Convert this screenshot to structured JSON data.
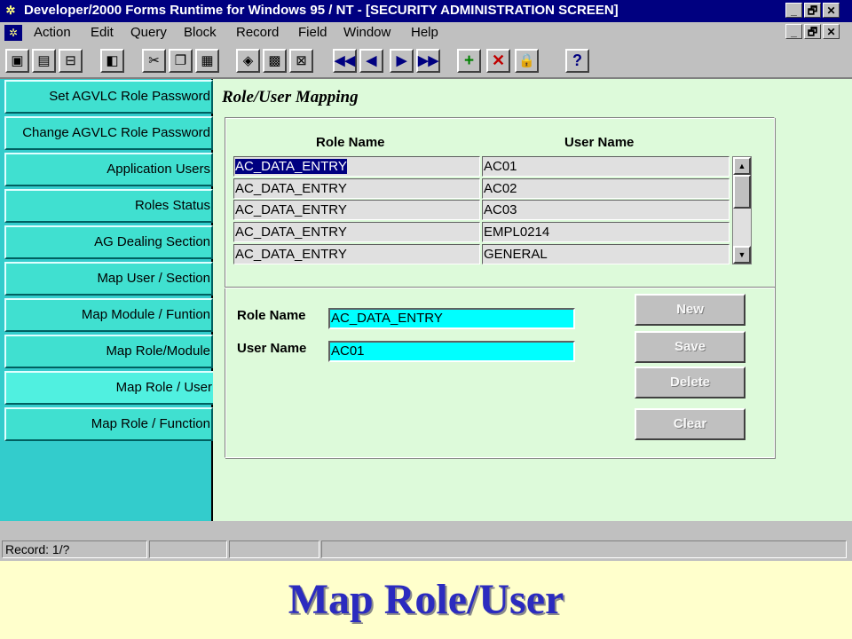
{
  "window": {
    "title": "Developer/2000 Forms Runtime for Windows 95 / NT - [SECURITY ADMINISTRATION SCREEN]",
    "title_buttons": [
      "_",
      "🗗",
      "✕"
    ],
    "menu_buttons": [
      "_",
      "🗗",
      "✕"
    ]
  },
  "menu": {
    "items": [
      "Action",
      "Edit",
      "Query",
      "Block",
      "Record",
      "Field",
      "Window",
      "Help"
    ]
  },
  "toolbar": {
    "icons": [
      "save-icon",
      "print-icon",
      "exit-icon",
      "door-icon",
      "cut-icon",
      "copy-icon",
      "paste-icon",
      "enter-query-icon",
      "execute-query-icon",
      "cancel-query-icon",
      "first-record-icon",
      "previous-record-icon",
      "next-record-icon",
      "last-record-icon",
      "insert-record-icon",
      "delete-record-icon",
      "lock-record-icon",
      "help-icon"
    ]
  },
  "nav": {
    "items": [
      {
        "label": "Set AGVLC Role Password"
      },
      {
        "label": "Change AGVLC Role Password"
      },
      {
        "label": "Application Users"
      },
      {
        "label": "Roles Status"
      },
      {
        "label": "AG Dealing Section"
      },
      {
        "label": "Map User / Section"
      },
      {
        "label": "Map Module / Funtion"
      },
      {
        "label": "Map Role/Module"
      },
      {
        "label": "Map Role / User"
      },
      {
        "label": "Map Role / Function"
      }
    ],
    "active_index": 8
  },
  "main": {
    "section_title": "Role/User Mapping",
    "grid": {
      "headers": [
        "Role Name",
        "User Name"
      ],
      "rows": [
        [
          "AC_DATA_ENTRY",
          "AC01"
        ],
        [
          "AC_DATA_ENTRY",
          "AC02"
        ],
        [
          "AC_DATA_ENTRY",
          "AC03"
        ],
        [
          "AC_DATA_ENTRY",
          "EMPL0214"
        ],
        [
          "AC_DATA_ENTRY",
          "GENERAL"
        ]
      ]
    },
    "form": {
      "role_label": "Role Name",
      "role_value": "AC_DATA_ENTRY",
      "user_label": "User Name",
      "user_value": "AC01"
    },
    "buttons": {
      "new": "New",
      "save": "Save",
      "delete": "Delete",
      "clear": "Clear"
    }
  },
  "status": {
    "record": "Record: 1/?"
  },
  "caption": "Map Role/User"
}
